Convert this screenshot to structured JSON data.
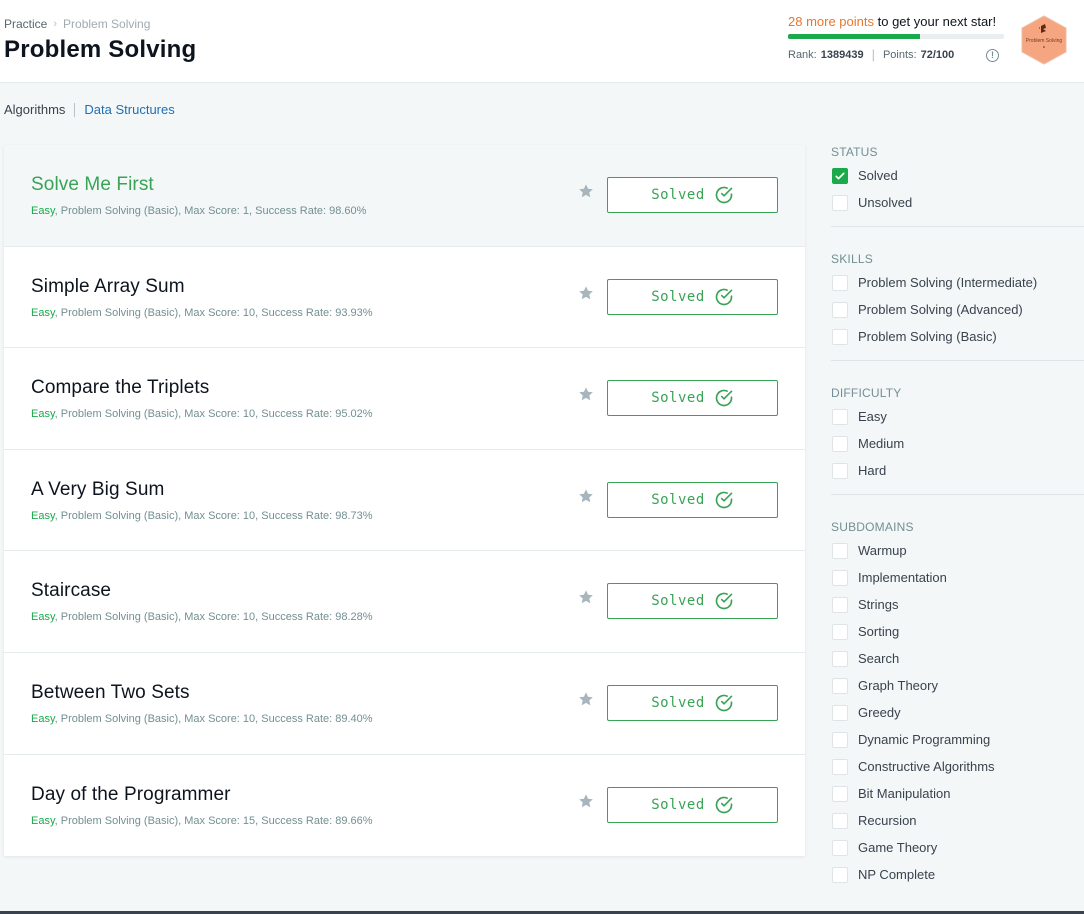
{
  "breadcrumb": {
    "root": "Practice",
    "current": "Problem Solving"
  },
  "page_title": "Problem Solving",
  "progress": {
    "points_needed": "28 more points",
    "suffix": " to get your next star!",
    "fraction": 0.61,
    "rank_label": "Rank:",
    "rank_value": "1389439",
    "points_label": "Points:",
    "points_value": "72/100",
    "info_glyph": "!",
    "badge_label": "Problem Solving",
    "badge_color": "#f5a57f",
    "bar_color": "#1ba94c"
  },
  "subnav": {
    "tabs": [
      "Algorithms",
      "Data Structures"
    ],
    "active": 1
  },
  "challenges": [
    {
      "title": "Solve Me First",
      "difficulty": "Easy",
      "meta": ", Problem Solving (Basic), Max Score: 1, Success Rate: 98.60%",
      "status": "Solved"
    },
    {
      "title": "Simple Array Sum",
      "difficulty": "Easy",
      "meta": ", Problem Solving (Basic), Max Score: 10, Success Rate: 93.93%",
      "status": "Solved"
    },
    {
      "title": "Compare the Triplets",
      "difficulty": "Easy",
      "meta": ", Problem Solving (Basic), Max Score: 10, Success Rate: 95.02%",
      "status": "Solved"
    },
    {
      "title": "A Very Big Sum",
      "difficulty": "Easy",
      "meta": ", Problem Solving (Basic), Max Score: 10, Success Rate: 98.73%",
      "status": "Solved"
    },
    {
      "title": "Staircase",
      "difficulty": "Easy",
      "meta": ", Problem Solving (Basic), Max Score: 10, Success Rate: 98.28%",
      "status": "Solved"
    },
    {
      "title": "Between Two Sets",
      "difficulty": "Easy",
      "meta": ", Problem Solving (Basic), Max Score: 10, Success Rate: 89.40%",
      "status": "Solved"
    },
    {
      "title": "Day of the Programmer",
      "difficulty": "Easy",
      "meta": ", Problem Solving (Basic), Max Score: 15, Success Rate: 89.66%",
      "status": "Solved"
    }
  ],
  "filters": {
    "status": {
      "title": "STATUS",
      "items": [
        {
          "label": "Solved",
          "checked": true
        },
        {
          "label": "Unsolved",
          "checked": false
        }
      ]
    },
    "skills": {
      "title": "SKILLS",
      "items": [
        {
          "label": "Problem Solving (Intermediate)",
          "checked": false
        },
        {
          "label": "Problem Solving (Advanced)",
          "checked": false
        },
        {
          "label": "Problem Solving (Basic)",
          "checked": false
        }
      ]
    },
    "difficulty": {
      "title": "DIFFICULTY",
      "items": [
        {
          "label": "Easy",
          "checked": false
        },
        {
          "label": "Medium",
          "checked": false
        },
        {
          "label": "Hard",
          "checked": false
        }
      ]
    },
    "subdomains": {
      "title": "SUBDOMAINS",
      "items": [
        {
          "label": "Warmup",
          "checked": false
        },
        {
          "label": "Implementation",
          "checked": false
        },
        {
          "label": "Strings",
          "checked": false
        },
        {
          "label": "Sorting",
          "checked": false
        },
        {
          "label": "Search",
          "checked": false
        },
        {
          "label": "Graph Theory",
          "checked": false
        },
        {
          "label": "Greedy",
          "checked": false
        },
        {
          "label": "Dynamic Programming",
          "checked": false
        },
        {
          "label": "Constructive Algorithms",
          "checked": false
        },
        {
          "label": "Bit Manipulation",
          "checked": false
        },
        {
          "label": "Recursion",
          "checked": false
        },
        {
          "label": "Game Theory",
          "checked": false
        },
        {
          "label": "NP Complete",
          "checked": false
        }
      ]
    }
  },
  "icons": {
    "star": "star-icon",
    "check": "check-circle-icon",
    "info": "info-icon",
    "badge": "hexagon-badge-icon"
  },
  "colors": {
    "accent_green": "#39a356",
    "success": "#1ba94c",
    "link_blue": "#1f6fb2",
    "points_orange": "#e8762e"
  }
}
